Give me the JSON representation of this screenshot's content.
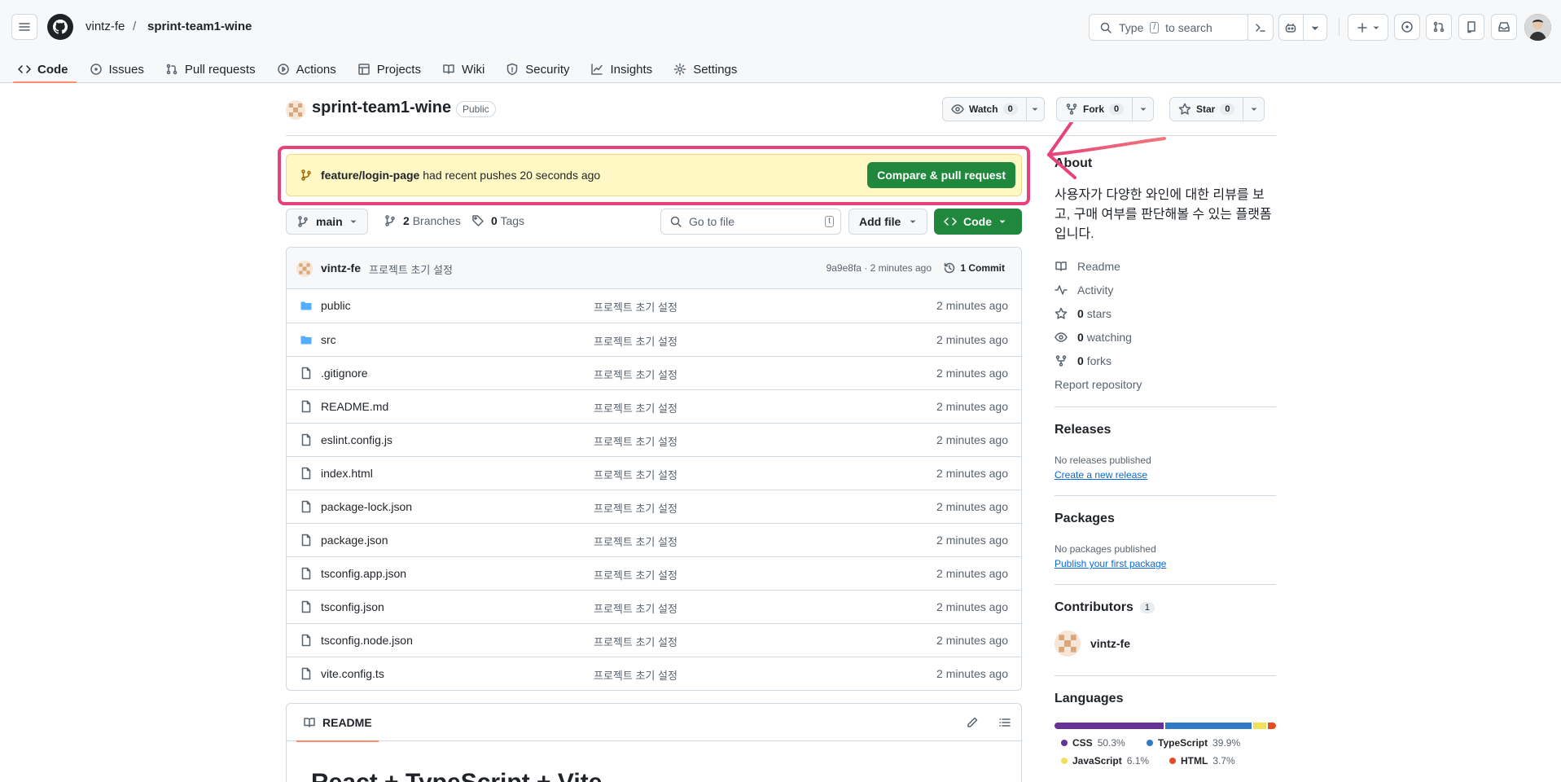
{
  "header": {
    "owner": "vintz-fe",
    "separator": "/",
    "repo": "sprint-team1-wine",
    "search_prefix": "Type",
    "search_key": "/",
    "search_suffix": "to search"
  },
  "nav": {
    "tabs": [
      {
        "label": "Code",
        "icon": "code-icon"
      },
      {
        "label": "Issues",
        "icon": "issue-icon"
      },
      {
        "label": "Pull requests",
        "icon": "pull-request-icon"
      },
      {
        "label": "Actions",
        "icon": "play-icon"
      },
      {
        "label": "Projects",
        "icon": "table-icon"
      },
      {
        "label": "Wiki",
        "icon": "book-icon"
      },
      {
        "label": "Security",
        "icon": "shield-icon"
      },
      {
        "label": "Insights",
        "icon": "graph-icon"
      },
      {
        "label": "Settings",
        "icon": "gear-icon"
      }
    ]
  },
  "repo": {
    "name": "sprint-team1-wine",
    "visibility": "Public",
    "watch_label": "Watch",
    "watch_count": "0",
    "fork_label": "Fork",
    "fork_count": "0",
    "star_label": "Star",
    "star_count": "0"
  },
  "banner": {
    "branch": "feature/login-page",
    "text": "had recent pushes 20 seconds ago",
    "button": "Compare & pull request"
  },
  "branch_bar": {
    "branch": "main",
    "branches_count": "2",
    "branches_label": "Branches",
    "tags_count": "0",
    "tags_label": "Tags",
    "goto_placeholder": "Go to file",
    "goto_key": "t",
    "add_file": "Add file",
    "code": "Code"
  },
  "commit": {
    "author": "vintz-fe",
    "message": "프로젝트 초기 설정",
    "info": "9a9e8fa · 2 minutes ago",
    "commits": "1 Commit"
  },
  "files": [
    {
      "name": "public",
      "type": "folder",
      "message": "프로젝트 초기 설정",
      "date": "2 minutes ago"
    },
    {
      "name": "src",
      "type": "folder",
      "message": "프로젝트 초기 설정",
      "date": "2 minutes ago"
    },
    {
      "name": ".gitignore",
      "type": "file",
      "message": "프로젝트 초기 설정",
      "date": "2 minutes ago"
    },
    {
      "name": "README.md",
      "type": "file",
      "message": "프로젝트 초기 설정",
      "date": "2 minutes ago"
    },
    {
      "name": "eslint.config.js",
      "type": "file",
      "message": "프로젝트 초기 설정",
      "date": "2 minutes ago"
    },
    {
      "name": "index.html",
      "type": "file",
      "message": "프로젝트 초기 설정",
      "date": "2 minutes ago"
    },
    {
      "name": "package-lock.json",
      "type": "file",
      "message": "프로젝트 초기 설정",
      "date": "2 minutes ago"
    },
    {
      "name": "package.json",
      "type": "file",
      "message": "프로젝트 초기 설정",
      "date": "2 minutes ago"
    },
    {
      "name": "tsconfig.app.json",
      "type": "file",
      "message": "프로젝트 초기 설정",
      "date": "2 minutes ago"
    },
    {
      "name": "tsconfig.json",
      "type": "file",
      "message": "프로젝트 초기 설정",
      "date": "2 minutes ago"
    },
    {
      "name": "tsconfig.node.json",
      "type": "file",
      "message": "프로젝트 초기 설정",
      "date": "2 minutes ago"
    },
    {
      "name": "vite.config.ts",
      "type": "file",
      "message": "프로젝트 초기 설정",
      "date": "2 minutes ago"
    }
  ],
  "readme": {
    "tab": "README",
    "heading": "React + TypeScript + Vite"
  },
  "sidebar": {
    "about_title": "About",
    "description": "사용자가 다양한 와인에 대한 리뷰를 보고, 구매 여부를 판단해볼 수 있는 플랫폼입니다.",
    "links": {
      "readme": "Readme",
      "activity": "Activity",
      "stars_count": "0",
      "stars_label": "stars",
      "watching_count": "0",
      "watching_label": "watching",
      "forks_count": "0",
      "forks_label": "forks",
      "report": "Report repository"
    },
    "releases_title": "Releases",
    "releases_none": "No releases published",
    "releases_link": "Create a new release",
    "packages_title": "Packages",
    "packages_none": "No packages published",
    "packages_link": "Publish your first package",
    "contributors_title": "Contributors",
    "contributors_count": "1",
    "contributor_name": "vintz-fe",
    "languages_title": "Languages",
    "languages": [
      {
        "name": "CSS",
        "percent": "50.3%",
        "value": 50.3,
        "color": "#663399"
      },
      {
        "name": "TypeScript",
        "percent": "39.9%",
        "value": 39.9,
        "color": "#3178c6"
      },
      {
        "name": "JavaScript",
        "percent": "6.1%",
        "value": 6.1,
        "color": "#f1e05a"
      },
      {
        "name": "HTML",
        "percent": "3.7%",
        "value": 3.7,
        "color": "#e34c26"
      }
    ]
  },
  "colors": {
    "primary_green": "#1f883d",
    "annotation_pink": "#e8427a",
    "banner_yellow": "#fff8c5",
    "tab_underline": "#fd8c73"
  }
}
